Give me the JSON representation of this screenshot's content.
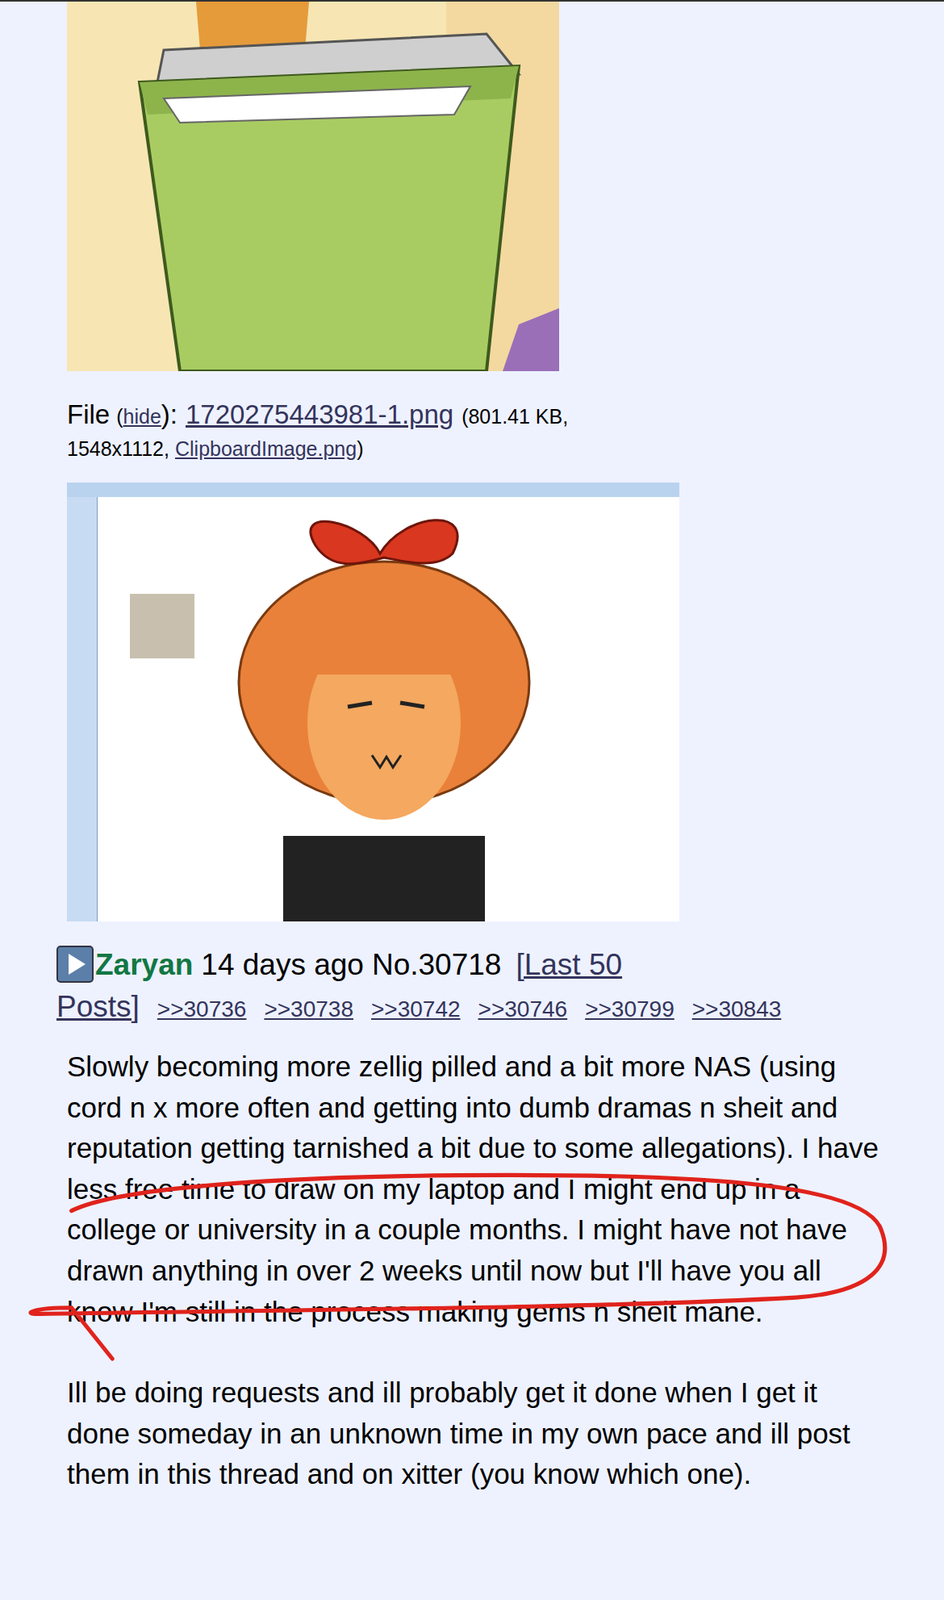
{
  "post": {
    "file": {
      "label": "File",
      "open": "(",
      "hide": "hide",
      "close_hide": "):",
      "name": "1720275443981-1.png",
      "meta": "(801.41 KB, 1548x1112,",
      "original": "ClipboardImage.png",
      "end": ")"
    },
    "author": "Zaryan",
    "time": "14 days ago",
    "number": "No.30718",
    "last_posts": "[Last 50 Posts]",
    "replies": [
      ">>30736",
      ">>30738",
      ">>30742",
      ">>30746",
      ">>30799",
      ">>30843"
    ],
    "paragraphs": [
      "Slowly becoming more zellig pilled and a bit more NAS (using cord n x more often and getting into dumb dramas n sheit and reputation getting tarnished a bit due to some allegations). I have less free time to draw on my laptop and I might end up in a college or university in a couple months. I might have not have drawn anything in over 2 weeks until now but I'll have you all know I'm still in the process making gems n sheit mane.",
      "Ill be doing requests and ill probably get it done when I get it done someday in an unknown time in my own pace and ill post them in this thread and on xitter (you know which one)."
    ]
  }
}
